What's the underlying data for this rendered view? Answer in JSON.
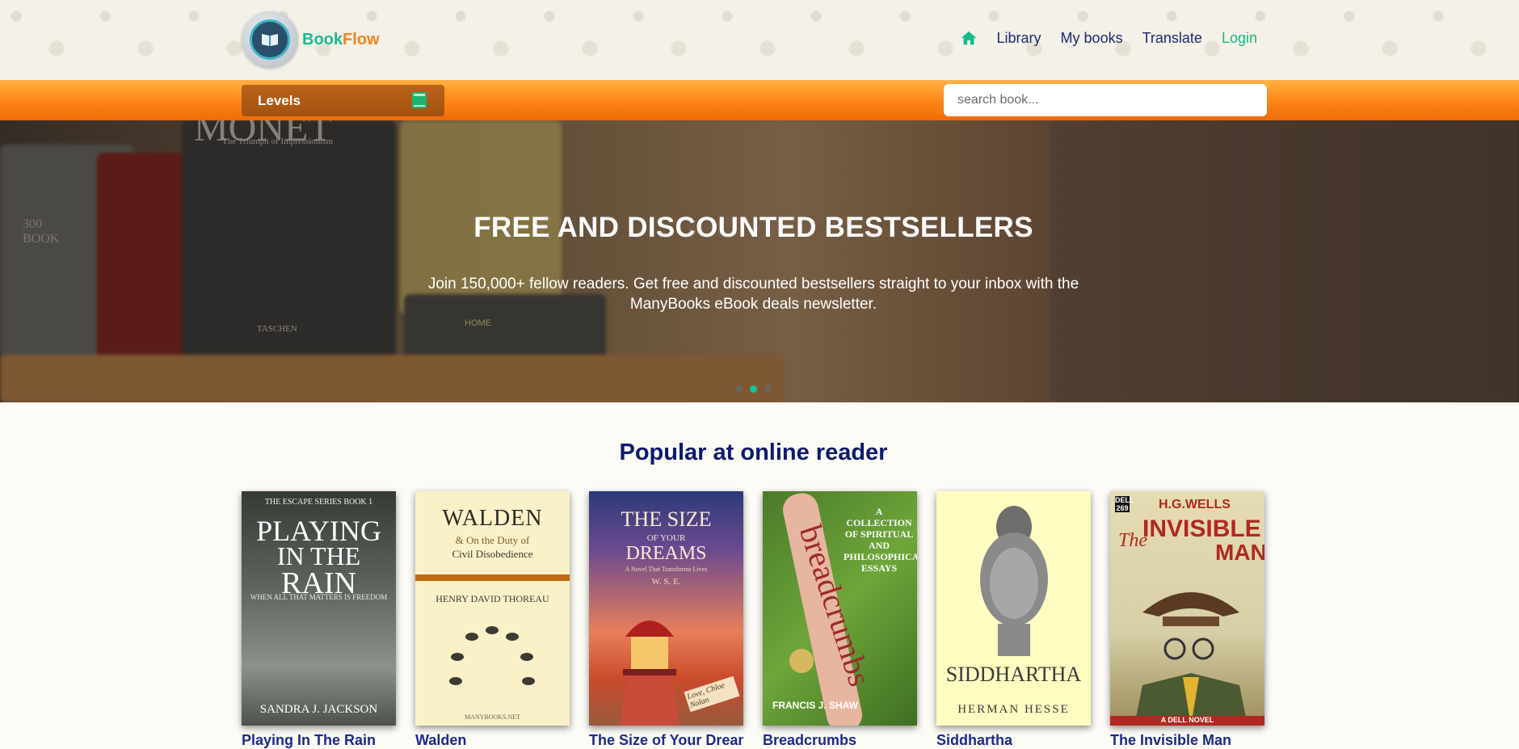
{
  "brand": {
    "part1": "Book",
    "part2": "Flow"
  },
  "nav": [
    {
      "label": "Library"
    },
    {
      "label": "My books"
    },
    {
      "label": "Translate"
    },
    {
      "label": "Login"
    }
  ],
  "levels": {
    "label": "Levels"
  },
  "search": {
    "placeholder": "search book..."
  },
  "hero": {
    "title": "FREE AND DISCOUNTED BESTSELLERS",
    "text": "Join 150,000+ fellow readers. Get free and discounted bestsellers straight to your inbox with the ManyBooks eBook deals newsletter.",
    "slides": 3,
    "active_slide": 2,
    "photo_text": {
      "book1_title": "MONET",
      "book1_sub": "The Triumph of Impressionism",
      "book1_pub": "TASCHEN",
      "book2": "300 BOOK",
      "sign": "HOME"
    }
  },
  "popular": {
    "title": "Popular at online reader",
    "books": [
      {
        "title": "Playing In The Rain",
        "cover": {
          "series": "THE ESCAPE SERIES BOOK 1",
          "line1": "PLAYING",
          "line2": "IN THE",
          "line3": "RAIN",
          "tagline": "WHEN ALL THAT MATTERS IS FREEDOM",
          "author": "SANDRA J. JACKSON"
        }
      },
      {
        "title": "Walden",
        "cover": {
          "line1": "WALDEN",
          "line2": "& On the Duty of",
          "line3": "Civil Disobedience",
          "author": "HENRY DAVID THOREAU",
          "footer": "MANYBOOKS.NET"
        }
      },
      {
        "title": "The Size of Your Dreams",
        "cover": {
          "line1": "THE SIZE",
          "line2": "OF YOUR",
          "line3": "DREAMS",
          "note": "A Novel That Transforms Lives",
          "author": "W. S. E.",
          "signature": "Love, Chloe Nolan"
        }
      },
      {
        "title": "Breadcrumbs",
        "cover": {
          "subtitle": "A COLLECTION OF SPIRITUAL AND PHILOSOPHICAL ESSAYS",
          "line1": "breadcrumbs",
          "author": "FRANCIS J. SHAW"
        }
      },
      {
        "title": "Siddhartha",
        "cover": {
          "line1": "SIDDHARTHA",
          "author": "HERMAN HESSE"
        }
      },
      {
        "title": "The Invisible Man",
        "cover": {
          "publisher": "DELL 269",
          "author": "H.G.WELLS",
          "line1": "The",
          "line2": "INVISIBLE",
          "line3": "MAN",
          "footer": "A DELL NOVEL"
        }
      }
    ]
  },
  "colors": {
    "accent_green": "#13b988",
    "brand_orange": "#f5841f",
    "nav_text": "#1d2a6b",
    "title_blue": "#0d1a6e"
  }
}
